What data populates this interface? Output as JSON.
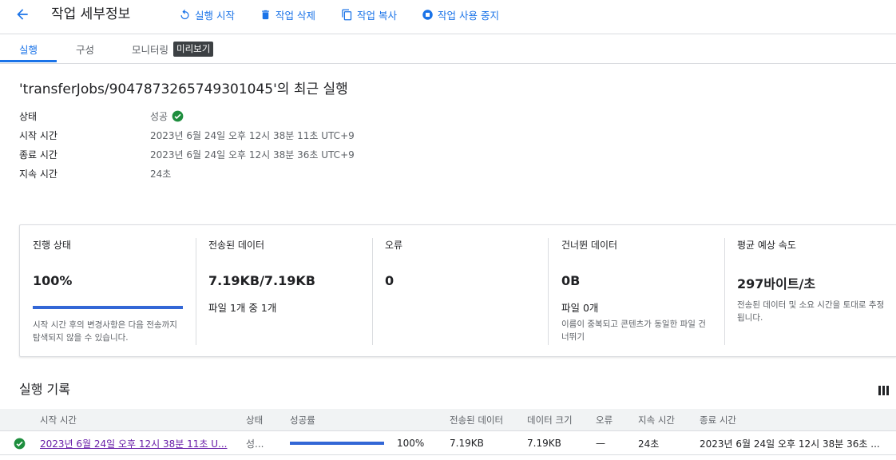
{
  "header": {
    "title": "작업 세부정보",
    "actions": [
      {
        "label": "실행 시작",
        "icon": "refresh-icon"
      },
      {
        "label": "작업 삭제",
        "icon": "trash-icon"
      },
      {
        "label": "작업 복사",
        "icon": "copy-icon"
      },
      {
        "label": "작업 사용 중지",
        "icon": "stop-icon"
      }
    ]
  },
  "tabs": [
    {
      "label": "실행",
      "active": true
    },
    {
      "label": "구성",
      "active": false
    },
    {
      "label": "모니터링",
      "active": false,
      "badge": "미리보기"
    }
  ],
  "run": {
    "title": "'transferJobs/9047873265749301045'의 최근 실행",
    "details": [
      {
        "label": "상태",
        "value": "성공"
      },
      {
        "label": "시작 시간",
        "value": "2023년 6월 24일 오후 12시 38분 11초 UTC+9"
      },
      {
        "label": "종료 시간",
        "value": "2023년 6월 24일 오후 12시 38분 36초 UTC+9"
      },
      {
        "label": "지속 시간",
        "value": "24초"
      }
    ]
  },
  "stats": {
    "progress": {
      "label": "진행 상태",
      "value": "100%",
      "fraction": 1.0,
      "note": "시작 시간 후의 변경사항은 다음 전송까지 탐색되지 않을 수 있습니다."
    },
    "transferred": {
      "label": "전송된 데이터",
      "value": "7.19KB/7.19KB",
      "sub": "파일 1개 중 1개"
    },
    "errors": {
      "label": "오류",
      "value": "0"
    },
    "skipped": {
      "label": "건너뛴 데이터",
      "value": "0B",
      "sub": "파일 0개",
      "note": "이름이 중복되고 콘텐츠가 동일한 파일 건너뛰기"
    },
    "speed": {
      "label": "평균 예상 속도",
      "value": "297바이트/초",
      "note": "전송된 데이터 및 소요 시간을 토대로 추정됩니다."
    }
  },
  "history": {
    "title": "실행 기록",
    "columns": [
      "시작 시간",
      "상태",
      "성공률",
      "전송된 데이터",
      "데이터 크기",
      "오류",
      "지속 시간",
      "종료 시간"
    ],
    "rows": [
      {
        "start": "2023년 6월 24일 오후 12시 38분 11초 U...",
        "status": "성...",
        "success_fraction": 1.0,
        "success": "100%",
        "transferred": "7.19KB",
        "size": "7.19KB",
        "errors": "—",
        "duration": "24초",
        "end": "2023년 6월 24일 오후 12시 38분 36초 ..."
      }
    ]
  },
  "colors": {
    "accent": "#1a73e8",
    "success": "#1e8e3e",
    "progress": "#3367d6",
    "link_visited": "#681da8"
  }
}
